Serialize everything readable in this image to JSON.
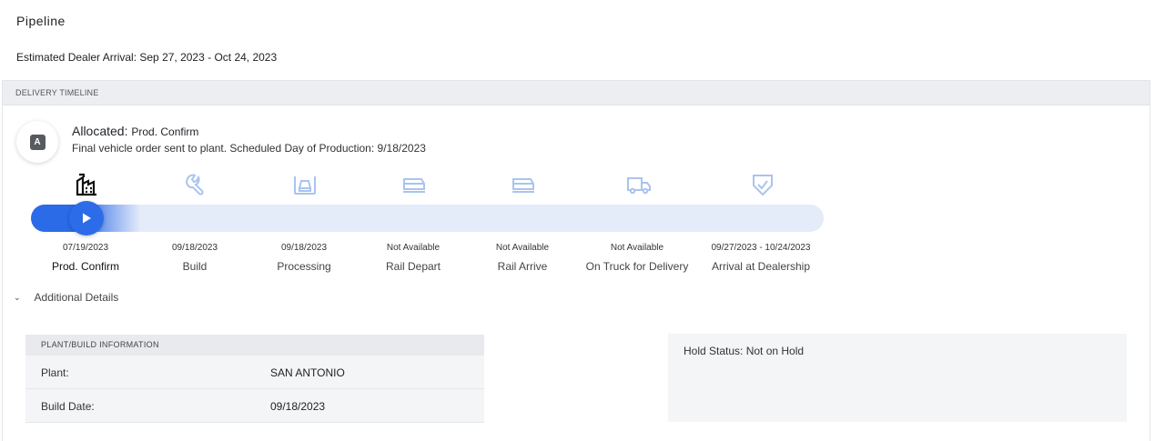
{
  "header": {
    "title": "Pipeline",
    "arrival_text": "Estimated Dealer Arrival: Sep 27, 2023 - Oct 24, 2023"
  },
  "timeline": {
    "section_label": "DELIVERY TIMELINE",
    "status": {
      "badge_letter": "A",
      "title": "Allocated:",
      "subtitle": "Prod. Confirm",
      "description": "Final vehicle order sent to plant. Scheduled Day of Production: 9/18/2023"
    },
    "progress": 0.07,
    "colors": {
      "accent": "#2d6ce9",
      "inactive_icon": "#a9c4ef",
      "active_icon": "#111111",
      "track": "#e4ebf9"
    },
    "stages": [
      {
        "label": "Prod. Confirm",
        "date": "07/19/2023",
        "icon": "factory-icon",
        "active": true
      },
      {
        "label": "Build",
        "date": "09/18/2023",
        "icon": "wrench-icon",
        "active": false
      },
      {
        "label": "Processing",
        "date": "09/18/2023",
        "icon": "car-processing-icon",
        "active": false
      },
      {
        "label": "Rail Depart",
        "date": "Not Available",
        "icon": "rail-car-icon",
        "active": false
      },
      {
        "label": "Rail Arrive",
        "date": "Not Available",
        "icon": "rail-car-icon",
        "active": false
      },
      {
        "label": "On Truck for Delivery",
        "date": "Not Available",
        "icon": "truck-icon",
        "active": false
      },
      {
        "label": "Arrival at Dealership",
        "date": "09/27/2023 - 10/24/2023",
        "icon": "shield-check-icon",
        "active": false
      }
    ]
  },
  "details": {
    "toggle_label": "Additional Details",
    "plant_info": {
      "header": "PLANT/BUILD INFORMATION",
      "rows": [
        {
          "label": "Plant:",
          "value": "SAN ANTONIO"
        },
        {
          "label": "Build Date:",
          "value": "09/18/2023"
        }
      ]
    },
    "hold_status": "Hold Status: Not on Hold"
  }
}
